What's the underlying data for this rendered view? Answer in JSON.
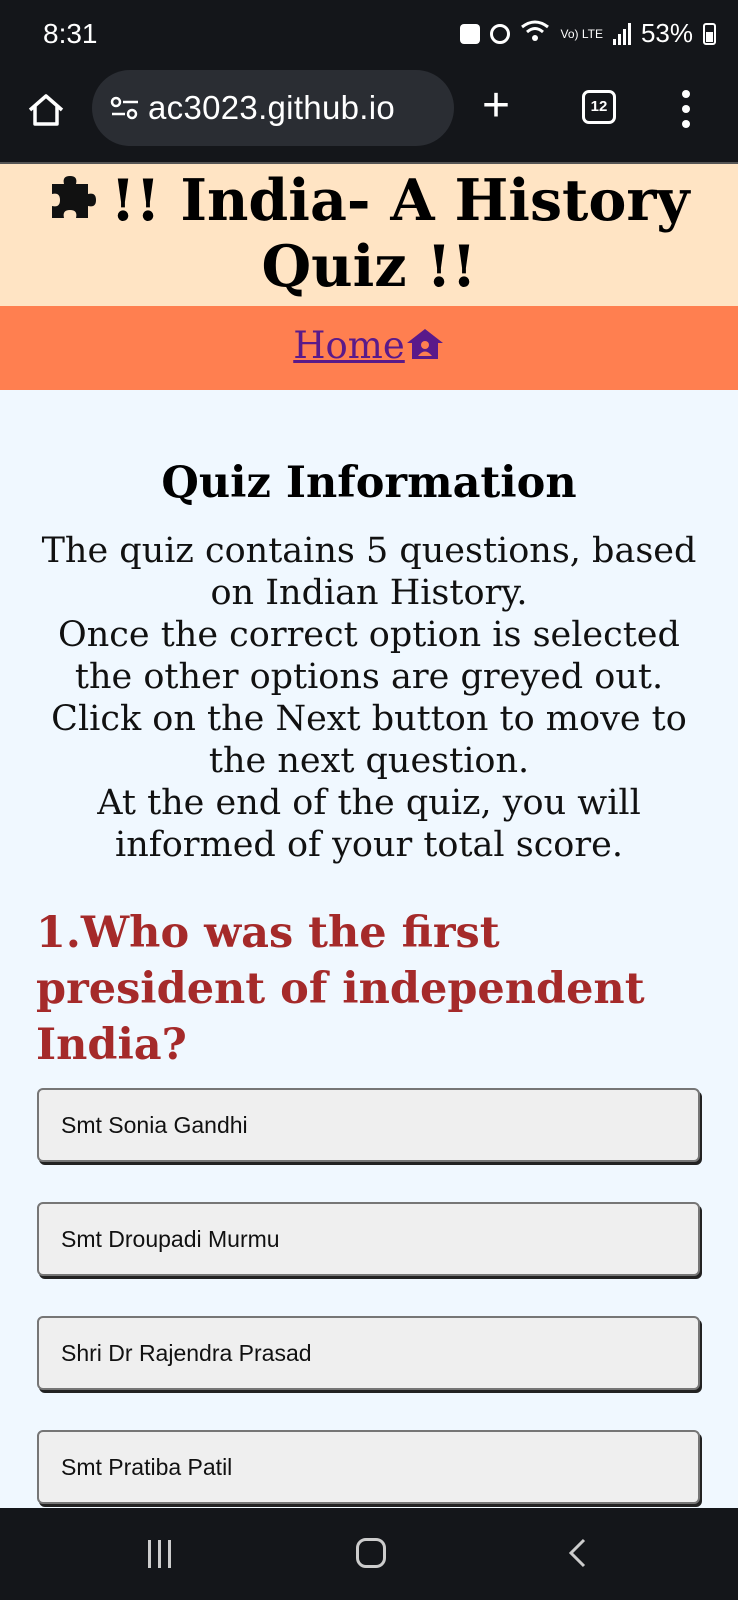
{
  "status_bar": {
    "time": "8:31",
    "battery_percent": "53%",
    "network": "Vo) LTE"
  },
  "browser": {
    "url": "ac3023.github.io",
    "tab_count": "12",
    "new_tab_symbol": "+"
  },
  "header": {
    "title": "!! India- A History Quiz !!",
    "icon": "puzzle-icon"
  },
  "nav": {
    "home_label": "Home",
    "home_icon": "house-user-icon"
  },
  "info": {
    "title": "Quiz Information",
    "lines": [
      "The quiz contains 5 questions, based on Indian History.",
      "Once the correct option is selected the other options are greyed out.",
      "Click on the Next button to move to the next question.",
      "At the end of the quiz, you will informed of your total score."
    ]
  },
  "quiz": {
    "question": "1.Who was the first president of independent India?",
    "options": [
      "Smt Sonia Gandhi",
      "Smt Droupadi Murmu",
      "Shri Dr Rajendra Prasad",
      "Smt Pratiba Patil"
    ]
  },
  "colors": {
    "header_bg": "#ffe4c4",
    "nav_bg": "#ff7f50",
    "page_bg": "#f0f8ff",
    "question_color": "#a52a2a",
    "link_color": "#5a1a8a"
  }
}
